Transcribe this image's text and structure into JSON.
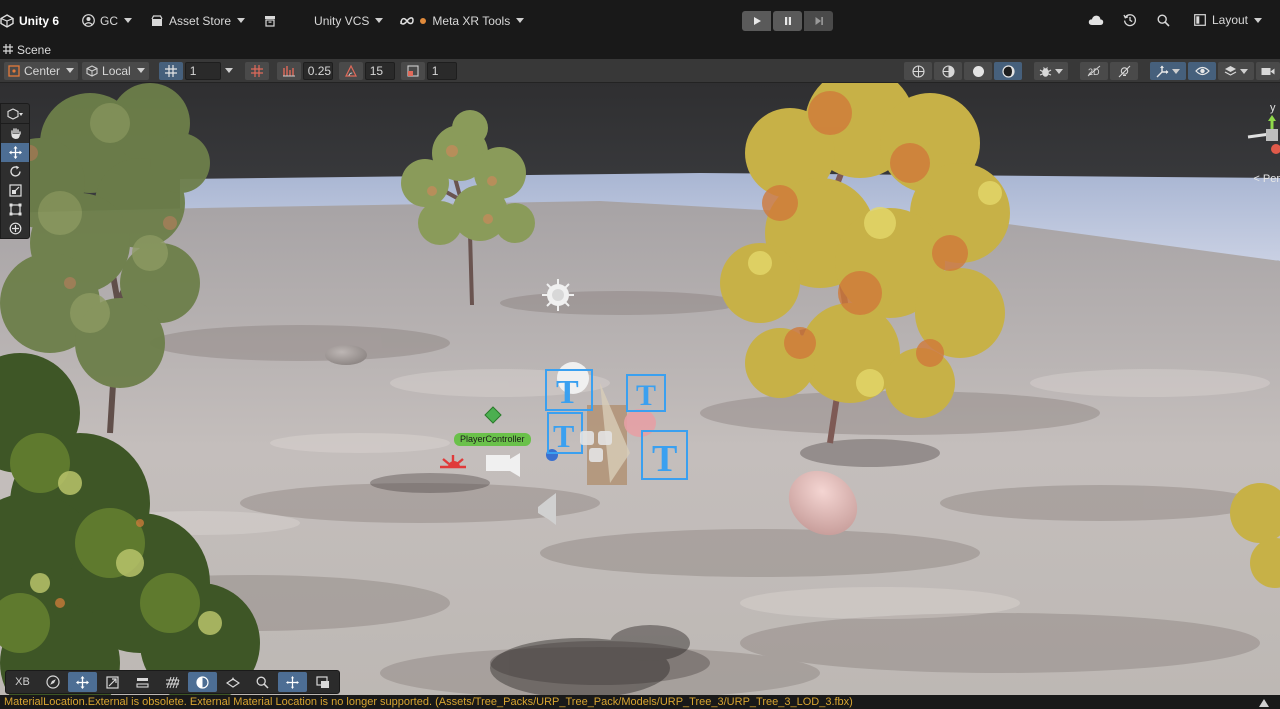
{
  "topbar": {
    "brand": "Unity 6",
    "account": "GC",
    "asset_store": "Asset Store",
    "version_control": "Unity VCS",
    "meta_tools": "Meta XR Tools",
    "layout": "Layout"
  },
  "scene": {
    "tab_label": "Scene",
    "pivot_mode": "Center",
    "pivot_rotation": "Local",
    "grid_size": "1",
    "snap_increment": "0.25",
    "rotation_snap": "15",
    "scale_snap": "1"
  },
  "viewport": {
    "player_label": "PlayerController",
    "gizmo_axis": "y",
    "gizmo_projection": "< Per"
  },
  "bottom_bar": {
    "xb_label": "XB"
  },
  "status": {
    "message": "MaterialLocation.External is obsolete. External Material Location is no longer supported. (Assets/Tree_Packs/URP_Tree_Pack/Models/URP_Tree_3/URP_Tree_3_LOD_3.fbx)"
  },
  "colors": {
    "accent": "#4d6e94",
    "warning": "#d8a531",
    "selection": "#3aa0f0"
  }
}
